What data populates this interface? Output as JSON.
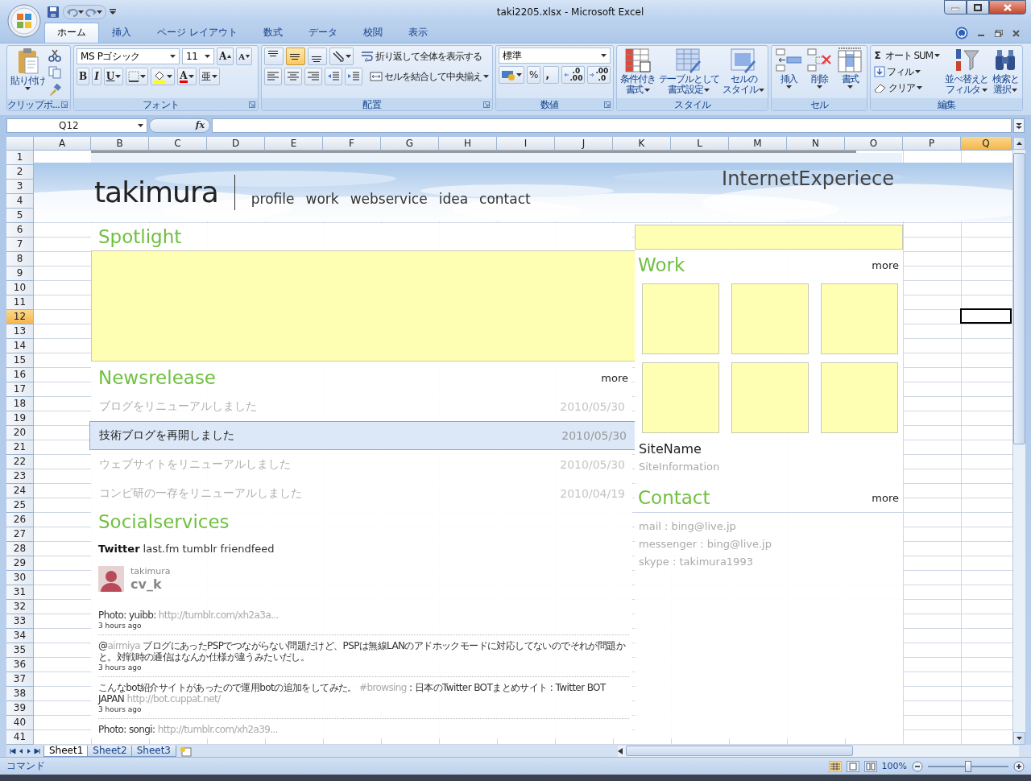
{
  "window": {
    "title": "taki2205.xlsx - Microsoft Excel"
  },
  "ribbon_tabs": [
    {
      "label": "ホーム",
      "selected": true
    },
    {
      "label": "挿入",
      "selected": false
    },
    {
      "label": "ページ レイアウト",
      "selected": false
    },
    {
      "label": "数式",
      "selected": false
    },
    {
      "label": "データ",
      "selected": false
    },
    {
      "label": "校閲",
      "selected": false
    },
    {
      "label": "表示",
      "selected": false
    }
  ],
  "ribbon": {
    "clipboard": {
      "label": "クリップボ...",
      "paste": "貼り付け"
    },
    "font": {
      "label": "フォント",
      "name": "MS Pゴシック",
      "size": "11",
      "grow": "A",
      "shrink": "A",
      "bold": "B",
      "italic": "I",
      "underline": "U",
      "color_button": "A",
      "phonetic": "亜"
    },
    "alignment": {
      "label": "配置",
      "vertical": [
        {
          "selected": false
        },
        {
          "selected": true
        },
        {
          "selected": false
        }
      ],
      "wrap": "折り返して全体を表示する",
      "merge": "セルを結合して中央揃え"
    },
    "number": {
      "label": "数値",
      "format": "標準",
      "percent": "%",
      "comma": ",",
      "decimals": [
        {
          "top": ".0",
          "bottom": ".00"
        },
        {
          "top": ".00",
          "bottom": ".0"
        }
      ]
    },
    "styles": {
      "label": "スタイル",
      "buttons": [
        {
          "lines": [
            "条件付き",
            "書式"
          ]
        },
        {
          "lines": [
            "テーブルとして",
            "書式設定"
          ]
        },
        {
          "lines": [
            "セルの",
            "スタイル"
          ]
        }
      ]
    },
    "cells": {
      "label": "セル",
      "buttons": [
        "挿入",
        "削除",
        "書式"
      ]
    },
    "editing": {
      "label": "編集",
      "sigma": "Σ",
      "autosum": "オート SUM",
      "fill": "フィル",
      "clear": "クリア",
      "sort": [
        "並べ替えと",
        "フィルタ"
      ],
      "find": [
        "検索と",
        "選択"
      ]
    }
  },
  "formula_bar": {
    "name_box": "Q12",
    "fx": "fx"
  },
  "columns": [
    {
      "label": "A",
      "selected": false
    },
    {
      "label": "B",
      "selected": false
    },
    {
      "label": "C",
      "selected": false
    },
    {
      "label": "D",
      "selected": false
    },
    {
      "label": "E",
      "selected": false
    },
    {
      "label": "F",
      "selected": false
    },
    {
      "label": "G",
      "selected": false
    },
    {
      "label": "H",
      "selected": false
    },
    {
      "label": "I",
      "selected": false
    },
    {
      "label": "J",
      "selected": false
    },
    {
      "label": "K",
      "selected": false
    },
    {
      "label": "L",
      "selected": false
    },
    {
      "label": "M",
      "selected": false
    },
    {
      "label": "N",
      "selected": false
    },
    {
      "label": "O",
      "selected": false
    },
    {
      "label": "P",
      "selected": false
    },
    {
      "label": "Q",
      "selected": true
    }
  ],
  "rows": [
    {
      "label": "1",
      "selected": false
    },
    {
      "label": "2",
      "selected": false
    },
    {
      "label": "3",
      "selected": false
    },
    {
      "label": "4",
      "selected": false
    },
    {
      "label": "5",
      "selected": false
    },
    {
      "label": "6",
      "selected": false
    },
    {
      "label": "7",
      "selected": false
    },
    {
      "label": "8",
      "selected": false
    },
    {
      "label": "9",
      "selected": false
    },
    {
      "label": "10",
      "selected": false
    },
    {
      "label": "11",
      "selected": false
    },
    {
      "label": "12",
      "selected": true
    },
    {
      "label": "13",
      "selected": false
    },
    {
      "label": "14",
      "selected": false
    },
    {
      "label": "15",
      "selected": false
    },
    {
      "label": "16",
      "selected": false
    },
    {
      "label": "17",
      "selected": false
    },
    {
      "label": "18",
      "selected": false
    },
    {
      "label": "19",
      "selected": false
    },
    {
      "label": "20",
      "selected": false
    },
    {
      "label": "21",
      "selected": false
    },
    {
      "label": "22",
      "selected": false
    },
    {
      "label": "23",
      "selected": false
    },
    {
      "label": "24",
      "selected": false
    },
    {
      "label": "25",
      "selected": false
    },
    {
      "label": "26",
      "selected": false
    },
    {
      "label": "27",
      "selected": false
    },
    {
      "label": "28",
      "selected": false
    },
    {
      "label": "29",
      "selected": false
    },
    {
      "label": "30",
      "selected": false
    },
    {
      "label": "31",
      "selected": false
    },
    {
      "label": "32",
      "selected": false
    },
    {
      "label": "33",
      "selected": false
    },
    {
      "label": "34",
      "selected": false
    },
    {
      "label": "35",
      "selected": false
    },
    {
      "label": "36",
      "selected": false
    },
    {
      "label": "37",
      "selected": false
    },
    {
      "label": "38",
      "selected": false
    },
    {
      "label": "39",
      "selected": false
    },
    {
      "label": "40",
      "selected": false
    },
    {
      "label": "41",
      "selected": false
    }
  ],
  "page": {
    "logo": "takimura",
    "nav": [
      "profile",
      "work",
      "webservice",
      "idea",
      "contact"
    ],
    "tagline": "InternetExperiece",
    "spotlight": {
      "heading": "Spotlight"
    },
    "news": {
      "heading": "Newsrelease",
      "more": "more",
      "items": [
        {
          "title": "ブログをリニューアルしました",
          "date": "2010/05/30",
          "selected": false
        },
        {
          "title": "技術ブログを再開しました",
          "date": "2010/05/30",
          "selected": true
        },
        {
          "title": "ウェブサイトをリニューアルしました",
          "date": "2010/05/30",
          "selected": false
        },
        {
          "title": "コンピ研の一存をリニューアルしました",
          "date": "2010/04/19",
          "selected": false
        }
      ]
    },
    "social": {
      "heading": "Socialservices",
      "tabs": [
        {
          "label": "Twitter",
          "selected": true
        },
        {
          "label": "last.fm",
          "selected": false
        },
        {
          "label": "tumblr",
          "selected": false
        },
        {
          "label": "friendfeed",
          "selected": false
        }
      ],
      "user": "takimura",
      "screen_name": "cv_k",
      "tweets": [
        {
          "parts": [
            {
              "text": "Photo: yuibb: ",
              "link": false
            },
            {
              "text": "http://tumblr.com/xh2a3a...",
              "link": true
            }
          ],
          "time": "3 hours ago"
        },
        {
          "parts": [
            {
              "text": "@",
              "link": false
            },
            {
              "text": "airmiya",
              "link": true
            },
            {
              "text": " ブログにあったPSPでつながらない問題だけど、PSPは無線LANのアドホックモードに対応してないのでそれが問題かと。対戦時の通信はなんか仕様が違うみたいだし。",
              "link": false
            }
          ],
          "time": "3 hours ago"
        },
        {
          "parts": [
            {
              "text": "こんなbot紹介サイトがあったので運用botの追加をしてみた。 ",
              "link": false
            },
            {
              "text": "#browsing",
              "link": true
            },
            {
              "text": " : 日本のTwitter BOTまとめサイト : Twitter BOT JAPAN ",
              "link": false
            },
            {
              "text": "http://bot.cuppat.net/",
              "link": true
            }
          ],
          "time": "3 hours ago"
        },
        {
          "parts": [
            {
              "text": "Photo: songi: ",
              "link": false
            },
            {
              "text": "http://tumblr.com/xh2a39...",
              "link": true
            }
          ]
        }
      ]
    },
    "work": {
      "heading": "Work",
      "more": "more",
      "site_name": "SiteName",
      "site_info": "SiteInformation"
    },
    "contact": {
      "heading": "Contact",
      "more": "more",
      "lines": [
        "mail : bing@live.jp",
        "messenger : bing@live.jp",
        "skype : takimura1993"
      ]
    }
  },
  "sheet_tabs": [
    {
      "label": "Sheet1",
      "selected": true
    },
    {
      "label": "Sheet2",
      "selected": false
    },
    {
      "label": "Sheet3",
      "selected": false
    }
  ],
  "status_bar": {
    "mode": "コマンド",
    "zoom": "100%",
    "zoom_slider": {
      "level": 0.5
    }
  }
}
